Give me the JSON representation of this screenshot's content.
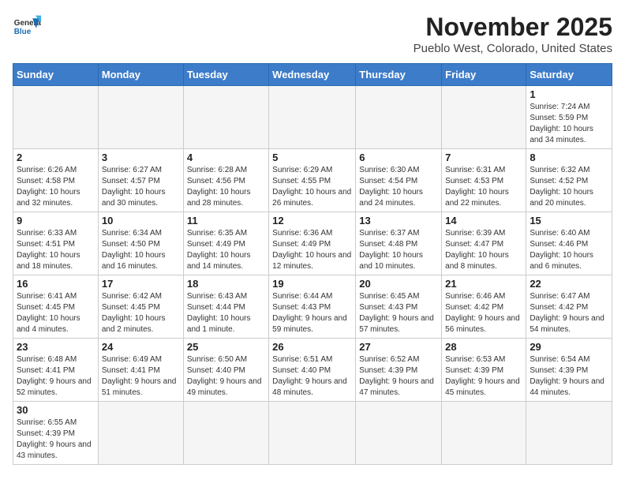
{
  "header": {
    "logo_line1": "General",
    "logo_line2": "Blue",
    "month_title": "November 2025",
    "location": "Pueblo West, Colorado, United States"
  },
  "weekdays": [
    "Sunday",
    "Monday",
    "Tuesday",
    "Wednesday",
    "Thursday",
    "Friday",
    "Saturday"
  ],
  "weeks": [
    [
      {
        "day": "",
        "info": ""
      },
      {
        "day": "",
        "info": ""
      },
      {
        "day": "",
        "info": ""
      },
      {
        "day": "",
        "info": ""
      },
      {
        "day": "",
        "info": ""
      },
      {
        "day": "",
        "info": ""
      },
      {
        "day": "1",
        "info": "Sunrise: 7:24 AM\nSunset: 5:59 PM\nDaylight: 10 hours\nand 34 minutes."
      }
    ],
    [
      {
        "day": "2",
        "info": "Sunrise: 6:26 AM\nSunset: 4:58 PM\nDaylight: 10 hours\nand 32 minutes."
      },
      {
        "day": "3",
        "info": "Sunrise: 6:27 AM\nSunset: 4:57 PM\nDaylight: 10 hours\nand 30 minutes."
      },
      {
        "day": "4",
        "info": "Sunrise: 6:28 AM\nSunset: 4:56 PM\nDaylight: 10 hours\nand 28 minutes."
      },
      {
        "day": "5",
        "info": "Sunrise: 6:29 AM\nSunset: 4:55 PM\nDaylight: 10 hours\nand 26 minutes."
      },
      {
        "day": "6",
        "info": "Sunrise: 6:30 AM\nSunset: 4:54 PM\nDaylight: 10 hours\nand 24 minutes."
      },
      {
        "day": "7",
        "info": "Sunrise: 6:31 AM\nSunset: 4:53 PM\nDaylight: 10 hours\nand 22 minutes."
      },
      {
        "day": "8",
        "info": "Sunrise: 6:32 AM\nSunset: 4:52 PM\nDaylight: 10 hours\nand 20 minutes."
      }
    ],
    [
      {
        "day": "9",
        "info": "Sunrise: 6:33 AM\nSunset: 4:51 PM\nDaylight: 10 hours\nand 18 minutes."
      },
      {
        "day": "10",
        "info": "Sunrise: 6:34 AM\nSunset: 4:50 PM\nDaylight: 10 hours\nand 16 minutes."
      },
      {
        "day": "11",
        "info": "Sunrise: 6:35 AM\nSunset: 4:49 PM\nDaylight: 10 hours\nand 14 minutes."
      },
      {
        "day": "12",
        "info": "Sunrise: 6:36 AM\nSunset: 4:49 PM\nDaylight: 10 hours\nand 12 minutes."
      },
      {
        "day": "13",
        "info": "Sunrise: 6:37 AM\nSunset: 4:48 PM\nDaylight: 10 hours\nand 10 minutes."
      },
      {
        "day": "14",
        "info": "Sunrise: 6:39 AM\nSunset: 4:47 PM\nDaylight: 10 hours\nand 8 minutes."
      },
      {
        "day": "15",
        "info": "Sunrise: 6:40 AM\nSunset: 4:46 PM\nDaylight: 10 hours\nand 6 minutes."
      }
    ],
    [
      {
        "day": "16",
        "info": "Sunrise: 6:41 AM\nSunset: 4:45 PM\nDaylight: 10 hours\nand 4 minutes."
      },
      {
        "day": "17",
        "info": "Sunrise: 6:42 AM\nSunset: 4:45 PM\nDaylight: 10 hours\nand 2 minutes."
      },
      {
        "day": "18",
        "info": "Sunrise: 6:43 AM\nSunset: 4:44 PM\nDaylight: 10 hours\nand 1 minute."
      },
      {
        "day": "19",
        "info": "Sunrise: 6:44 AM\nSunset: 4:43 PM\nDaylight: 9 hours\nand 59 minutes."
      },
      {
        "day": "20",
        "info": "Sunrise: 6:45 AM\nSunset: 4:43 PM\nDaylight: 9 hours\nand 57 minutes."
      },
      {
        "day": "21",
        "info": "Sunrise: 6:46 AM\nSunset: 4:42 PM\nDaylight: 9 hours\nand 56 minutes."
      },
      {
        "day": "22",
        "info": "Sunrise: 6:47 AM\nSunset: 4:42 PM\nDaylight: 9 hours\nand 54 minutes."
      }
    ],
    [
      {
        "day": "23",
        "info": "Sunrise: 6:48 AM\nSunset: 4:41 PM\nDaylight: 9 hours\nand 52 minutes."
      },
      {
        "day": "24",
        "info": "Sunrise: 6:49 AM\nSunset: 4:41 PM\nDaylight: 9 hours\nand 51 minutes."
      },
      {
        "day": "25",
        "info": "Sunrise: 6:50 AM\nSunset: 4:40 PM\nDaylight: 9 hours\nand 49 minutes."
      },
      {
        "day": "26",
        "info": "Sunrise: 6:51 AM\nSunset: 4:40 PM\nDaylight: 9 hours\nand 48 minutes."
      },
      {
        "day": "27",
        "info": "Sunrise: 6:52 AM\nSunset: 4:39 PM\nDaylight: 9 hours\nand 47 minutes."
      },
      {
        "day": "28",
        "info": "Sunrise: 6:53 AM\nSunset: 4:39 PM\nDaylight: 9 hours\nand 45 minutes."
      },
      {
        "day": "29",
        "info": "Sunrise: 6:54 AM\nSunset: 4:39 PM\nDaylight: 9 hours\nand 44 minutes."
      }
    ],
    [
      {
        "day": "30",
        "info": "Sunrise: 6:55 AM\nSunset: 4:39 PM\nDaylight: 9 hours\nand 43 minutes."
      },
      {
        "day": "",
        "info": ""
      },
      {
        "day": "",
        "info": ""
      },
      {
        "day": "",
        "info": ""
      },
      {
        "day": "",
        "info": ""
      },
      {
        "day": "",
        "info": ""
      },
      {
        "day": "",
        "info": ""
      }
    ]
  ]
}
